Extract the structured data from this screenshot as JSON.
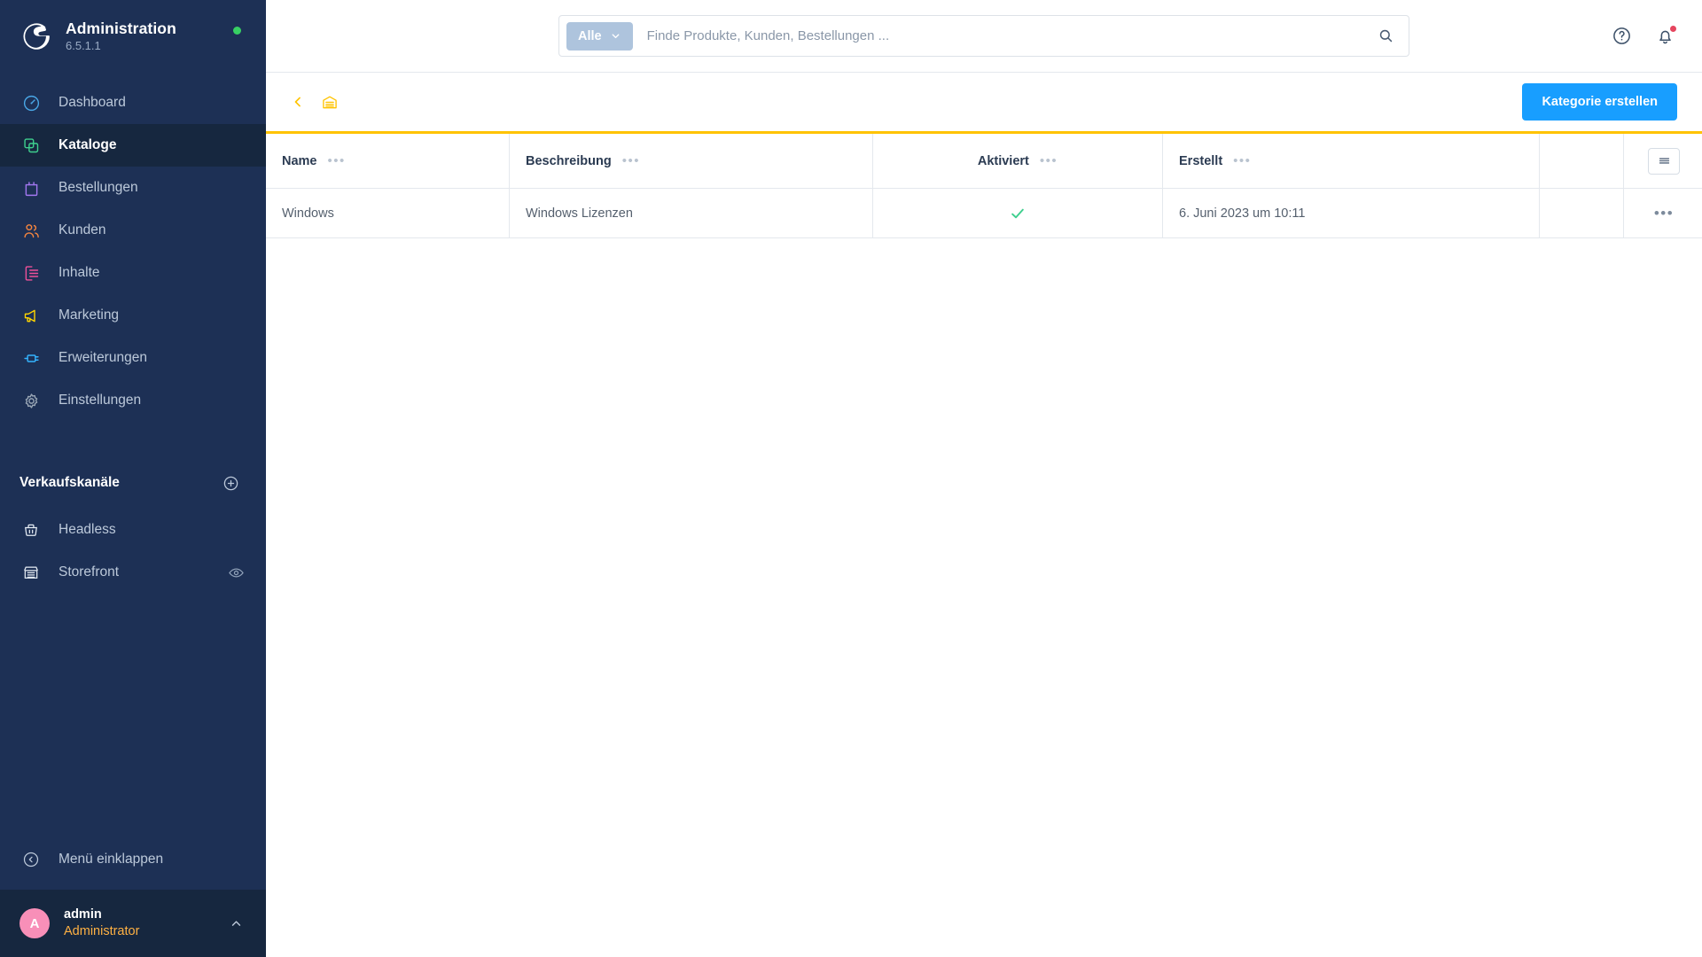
{
  "sidebar": {
    "brand": {
      "logo_icon": "shopware-logo-icon",
      "title": "Administration",
      "version": "6.5.1.1",
      "status_icon": "status-dot-online",
      "status_color": "#37d063"
    },
    "nav_items": [
      {
        "label": "Dashboard",
        "icon": "dashboard-icon",
        "color": "#4aa8e8",
        "active": false
      },
      {
        "label": "Kataloge",
        "icon": "catalogs-icon",
        "color": "#3ecf8e",
        "active": true
      },
      {
        "label": "Bestellungen",
        "icon": "orders-icon",
        "color": "#a277f0",
        "active": false
      },
      {
        "label": "Kunden",
        "icon": "customers-icon",
        "color": "#f5853f",
        "active": false
      },
      {
        "label": "Inhalte",
        "icon": "content-icon",
        "color": "#f0509a",
        "active": false
      },
      {
        "label": "Marketing",
        "icon": "marketing-icon",
        "color": "#ffd500",
        "active": false
      },
      {
        "label": "Erweiterungen",
        "icon": "extensions-icon",
        "color": "#34b4ff",
        "active": false
      },
      {
        "label": "Einstellungen",
        "icon": "settings-gear-icon",
        "color": "#9aa7b6",
        "active": false
      }
    ],
    "sales_channels": {
      "title": "Verkaufskanäle",
      "add_icon": "plus-circle-icon",
      "items": [
        {
          "label": "Headless",
          "icon": "basket-icon",
          "trailing_icon": ""
        },
        {
          "label": "Storefront",
          "icon": "storefront-icon",
          "trailing_icon": "eye-icon"
        }
      ]
    },
    "collapse": {
      "label": "Menü einklappen",
      "icon": "chevron-left-circle-icon"
    },
    "user": {
      "avatar_initial": "A",
      "name": "admin",
      "role": "Administrator",
      "expand_icon": "chevron-up-icon"
    }
  },
  "topbar": {
    "search": {
      "scope_label": "Alle",
      "scope_chevron_icon": "chevron-down-icon",
      "placeholder": "Finde Produkte, Kunden, Bestellungen ...",
      "value": "",
      "search_icon": "search-icon"
    },
    "actions": [
      {
        "name": "help-icon",
        "label": ""
      },
      {
        "name": "notifications-icon",
        "label": ""
      }
    ]
  },
  "toolbar": {
    "back_icon": "chevron-left-icon",
    "home_icon": "warehouse-icon",
    "create_button": "Kategorie erstellen",
    "accent_color": "#ffc300",
    "primary_color": "#189eff"
  },
  "table": {
    "columns": [
      {
        "label": "Name",
        "menu_icon": "column-menu-icon",
        "align": "left"
      },
      {
        "label": "Beschreibung",
        "menu_icon": "column-menu-icon",
        "align": "left"
      },
      {
        "label": "Aktiviert",
        "menu_icon": "column-menu-icon",
        "align": "center"
      },
      {
        "label": "Erstellt",
        "menu_icon": "column-menu-icon",
        "align": "left"
      }
    ],
    "settings_icon": "list-settings-icon",
    "rows": [
      {
        "name": "Windows",
        "description": "Windows Lizenzen",
        "active": true,
        "active_icon": "check-icon",
        "active_color": "#3ecf8e",
        "created": "6. Juni 2023 um 10:11",
        "menu_icon": "row-menu-icon"
      }
    ]
  }
}
